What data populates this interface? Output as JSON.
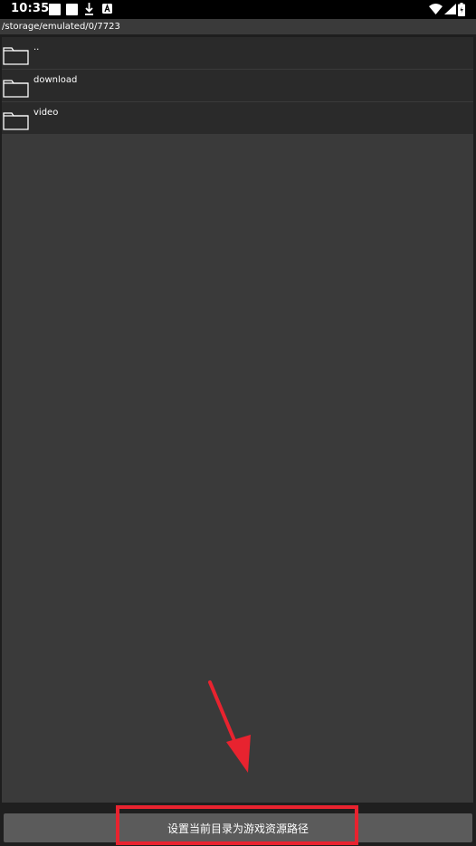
{
  "status_bar": {
    "time": "10:35",
    "notification_icons": [
      "square-icon",
      "square-icon",
      "download-icon",
      "a-icon"
    ],
    "right_icons": [
      "wifi-icon",
      "signal-icon",
      "battery-icon"
    ]
  },
  "path": "/storage/emulated/0/7723",
  "files": [
    {
      "name": "..",
      "icon": "folder-icon"
    },
    {
      "name": "download",
      "icon": "folder-icon"
    },
    {
      "name": "video",
      "icon": "folder-icon"
    }
  ],
  "action_button_label": "设置当前目录为游戏资源路径",
  "annotation": {
    "highlight_color": "#e8232f",
    "arrow_color": "#e8232f"
  },
  "colors": {
    "panel_bg": "#3a3a3a",
    "row_bg": "#2a2a2a",
    "button_bg": "#5b5b5b"
  }
}
